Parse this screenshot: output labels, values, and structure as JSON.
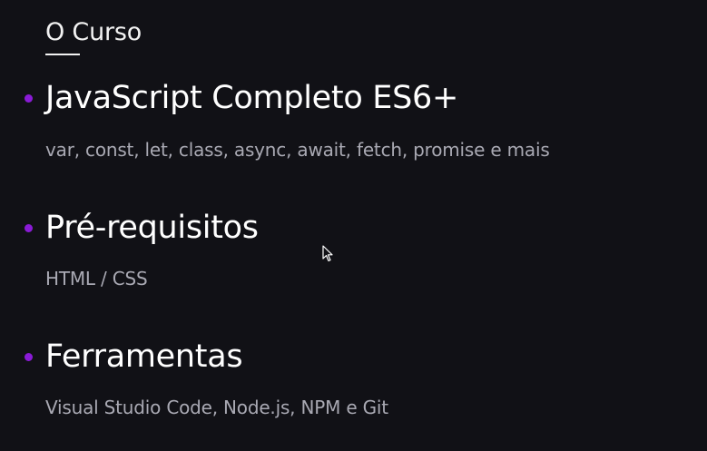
{
  "header": {
    "title": "O Curso"
  },
  "items": [
    {
      "title": "JavaScript Completo ES6+",
      "description": "var, const, let, class, async, await, fetch, promise e mais"
    },
    {
      "title": "Pré-requisitos",
      "description": "HTML / CSS"
    },
    {
      "title": "Ferramentas",
      "description": "Visual Studio Code, Node.js, NPM e Git"
    }
  ],
  "colors": {
    "background": "#111116",
    "bullet": "#8a1bd6",
    "title": "#ffffff",
    "description": "#a9a9b3"
  },
  "icons": {
    "bullet": "purple-dot-icon",
    "cursor": "mouse-pointer-icon"
  }
}
